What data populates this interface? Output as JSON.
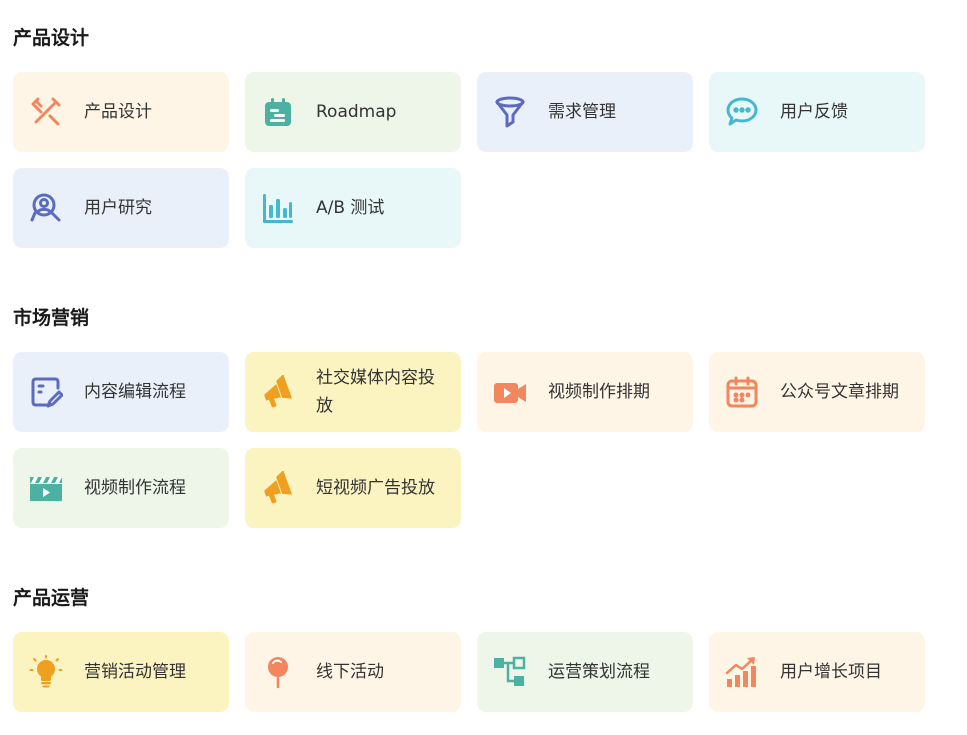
{
  "sections": [
    {
      "title": "产品设计",
      "cards": [
        {
          "label": "产品设计",
          "icon": "design-tools-icon",
          "color": "#f2865e",
          "bg": "#fef5e7"
        },
        {
          "label": "Roadmap",
          "icon": "roadmap-icon",
          "color": "#4cb1a0",
          "bg": "#eef6e9"
        },
        {
          "label": "需求管理",
          "icon": "funnel-icon",
          "color": "#5b6bc0",
          "bg": "#eaf0fa"
        },
        {
          "label": "用户反馈",
          "icon": "chat-bubble-icon",
          "color": "#45b8d0",
          "bg": "#e8f7f7"
        },
        {
          "label": "用户研究",
          "icon": "user-search-icon",
          "color": "#5b6bc0",
          "bg": "#eaf0fa"
        },
        {
          "label": "A/B 测试",
          "icon": "bar-chart-icon",
          "color": "#45b8d0",
          "bg": "#e8f7f7"
        }
      ]
    },
    {
      "title": "市场营销",
      "cards": [
        {
          "label": "内容编辑流程",
          "icon": "edit-document-icon",
          "color": "#5b6bc0",
          "bg": "#eaf0fa"
        },
        {
          "label": "社交媒体内容投放",
          "icon": "megaphone-icon",
          "color": "#f0a020",
          "bg": "#fbf3c0"
        },
        {
          "label": "视频制作排期",
          "icon": "video-camera-icon",
          "color": "#f2865e",
          "bg": "#fef5e7"
        },
        {
          "label": "公众号文章排期",
          "icon": "calendar-icon",
          "color": "#f2865e",
          "bg": "#fef5e7"
        },
        {
          "label": "视频制作流程",
          "icon": "clapperboard-icon",
          "color": "#4cb1a0",
          "bg": "#eef6e9"
        },
        {
          "label": "短视频广告投放",
          "icon": "megaphone-icon",
          "color": "#f0a020",
          "bg": "#fbf3c0"
        }
      ]
    },
    {
      "title": "产品运营",
      "cards": [
        {
          "label": "营销活动管理",
          "icon": "lightbulb-icon",
          "color": "#f0a020",
          "bg": "#fbf3c0"
        },
        {
          "label": "线下活动",
          "icon": "location-pin-icon",
          "color": "#f2865e",
          "bg": "#fef5e7"
        },
        {
          "label": "运营策划流程",
          "icon": "flowchart-icon",
          "color": "#4cb1a0",
          "bg": "#eef6e9"
        },
        {
          "label": "用户增长项目",
          "icon": "growth-chart-icon",
          "color": "#f2865e",
          "bg": "#fef5e7"
        }
      ]
    }
  ]
}
